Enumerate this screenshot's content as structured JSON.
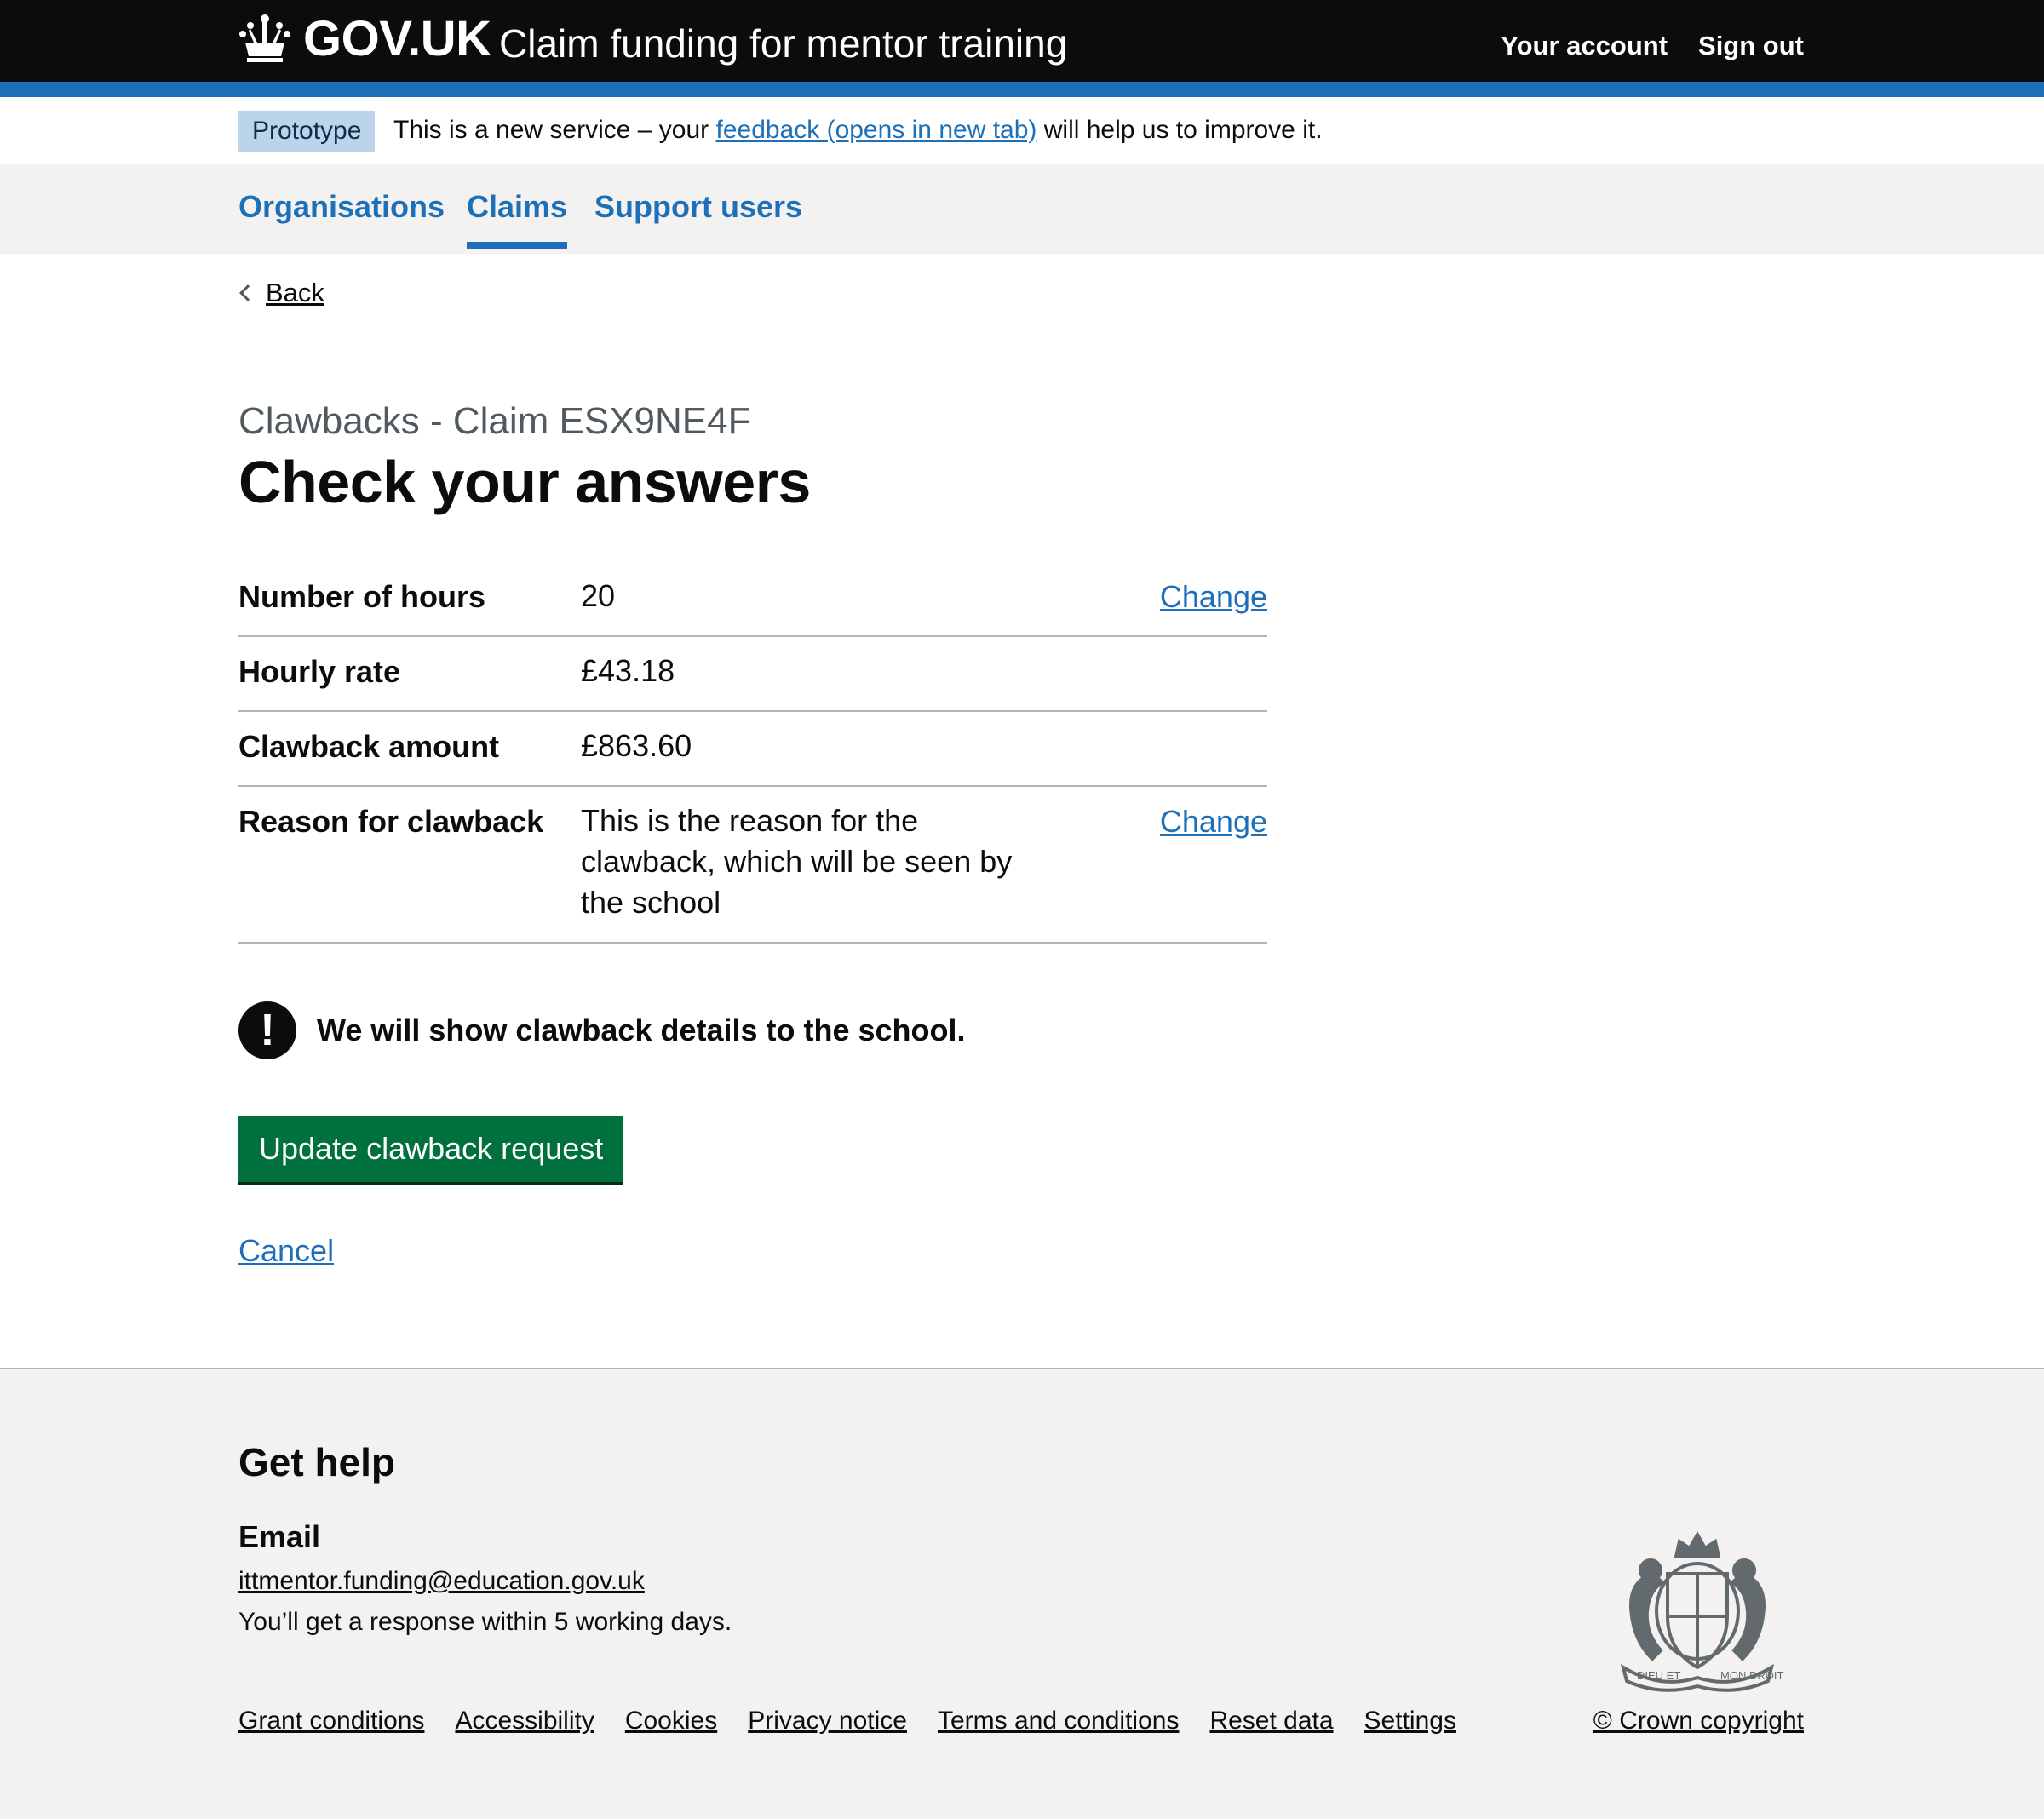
{
  "header": {
    "logo_text": "GOV.UK",
    "service_name": "Claim funding for mentor training",
    "nav": [
      "Your account",
      "Sign out"
    ]
  },
  "phase_banner": {
    "tag": "Prototype",
    "text_before": "This is a new service – your",
    "link": "feedback (opens in new tab)",
    "text_after": "will help us to improve it."
  },
  "service_nav": {
    "items": [
      "Organisations",
      "Claims",
      "Support users"
    ],
    "active": "Claims"
  },
  "back_label": "Back",
  "caption": "Clawbacks - Claim ESX9NE4F",
  "title": "Check your answers",
  "summary": [
    {
      "key": "Number of hours",
      "value": "20",
      "action": "Change"
    },
    {
      "key": "Hourly rate",
      "value": "£43.18",
      "action": ""
    },
    {
      "key": "Clawback amount",
      "value": "£863.60",
      "action": ""
    },
    {
      "key": "Reason for clawback",
      "value": "This is the reason for the clawback, which will be seen by the school",
      "action": "Change"
    }
  ],
  "warning": {
    "icon": "!",
    "text": "We will show clawback details to the school."
  },
  "primary_button": "Update clawback request",
  "cancel_link": "Cancel",
  "footer": {
    "heading": "Get help",
    "email_heading": "Email",
    "email": "ittmentor.funding@education.gov.uk",
    "response": "You’ll get a response within 5 working days.",
    "links": [
      "Grant conditions",
      "Accessibility",
      "Cookies",
      "Privacy notice",
      "Terms and conditions",
      "Reset data",
      "Settings"
    ],
    "copyright": "© Crown copyright",
    "crest_motto_left": "DIEU ET",
    "crest_motto_right": "MON DROIT"
  },
  "colors": {
    "brand": "#1d70b8",
    "header_bg": "#0b0c0c",
    "button": "#00703c",
    "nav_bg": "#f3f2f1"
  }
}
